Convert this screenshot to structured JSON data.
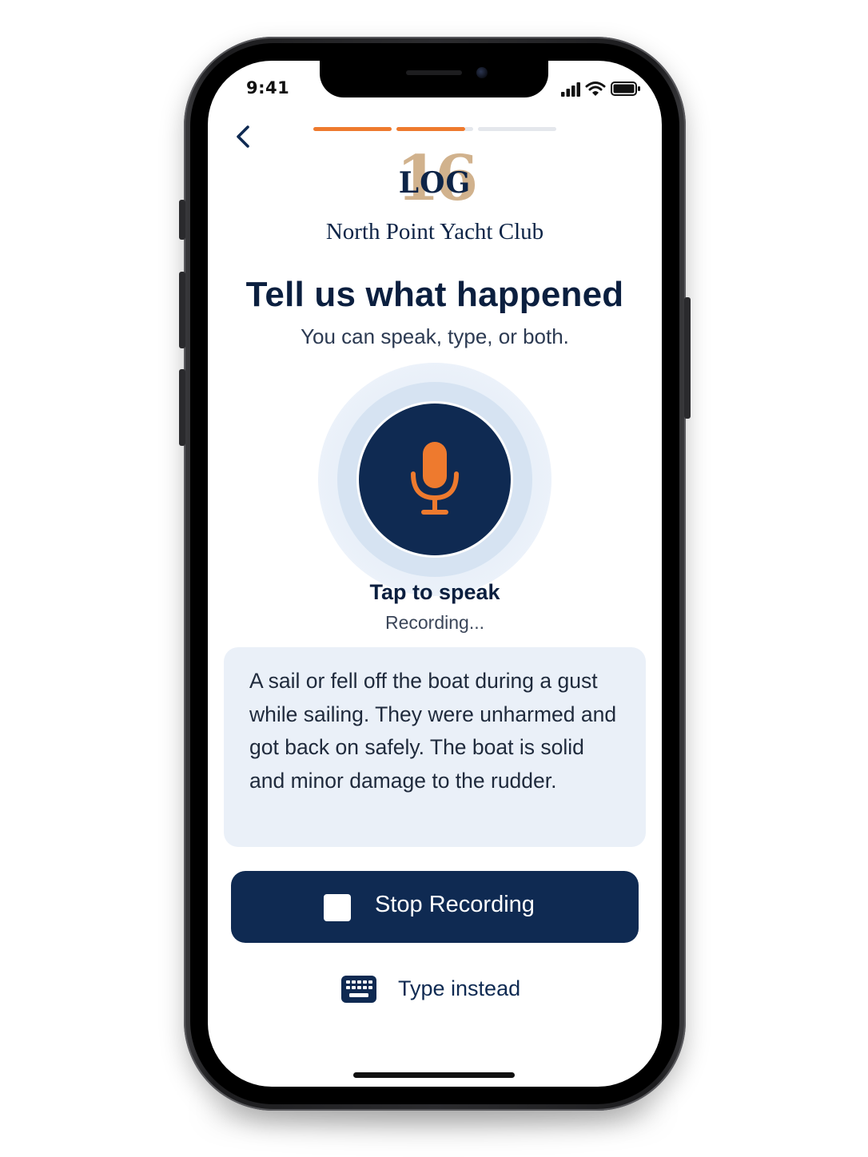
{
  "status_bar": {
    "time": "9:41",
    "icons": [
      "cellular-signal-icon",
      "wifi-icon",
      "battery-icon"
    ]
  },
  "navigation": {
    "back_icon": "chevron-left-icon",
    "progress_steps": [
      {
        "state": "complete",
        "color": "#ee7a2e"
      },
      {
        "state": "current",
        "color": "#ee7a2e"
      },
      {
        "state": "upcoming",
        "color": "#e4e7ec"
      }
    ]
  },
  "brand": {
    "logo_number": "16",
    "logo_word": "LOG",
    "club_name": "North Point Yacht Club",
    "colors": {
      "navy": "#0f2a52",
      "gold": "#c9a57a",
      "orange": "#ee7a2e"
    }
  },
  "header": {
    "title": "Tell us what happened",
    "subtitle": "You can speak, type, or both."
  },
  "voice": {
    "mic_icon": "microphone-icon",
    "action_label": "Tap to speak",
    "status": "Recording..."
  },
  "transcript": {
    "text": "A sail or fell off the boat during a gust while sailing. They were unharmed and got back on safely. The boat is solid and minor damage to the rudder."
  },
  "actions": {
    "stop_label": "Stop Recording",
    "stop_icon": "stop-square-icon",
    "type_label": "Type instead",
    "type_icon": "keyboard-icon"
  }
}
